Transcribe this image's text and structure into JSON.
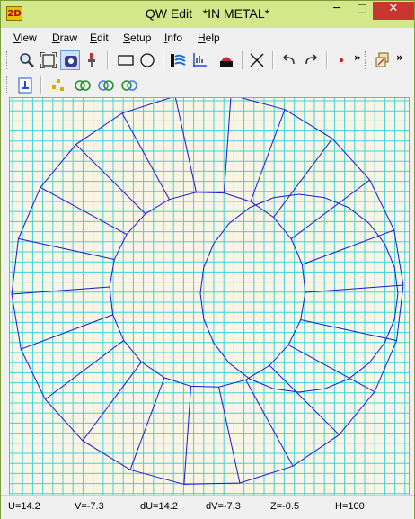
{
  "window": {
    "icon_text": "2D",
    "title": "QW Edit   *IN METAL*",
    "minimize": "─",
    "maximize": "□",
    "close": "✕"
  },
  "menu": [
    {
      "label": "View",
      "accel": "V",
      "rest": "iew"
    },
    {
      "label": "Draw",
      "accel": "D",
      "rest": "raw"
    },
    {
      "label": "Edit",
      "accel": "E",
      "rest": "dit"
    },
    {
      "label": "Setup",
      "accel": "S",
      "rest": "etup"
    },
    {
      "label": "Info",
      "accel": "I",
      "rest": "nfo"
    },
    {
      "label": "Help",
      "accel": "H",
      "rest": "elp"
    }
  ],
  "toolbar": {
    "overflow_1": "»",
    "overflow_2": "»",
    "icons": [
      "zoom-icon",
      "fit-view-icon",
      "select-mode-icon",
      "probe-icon",
      "rectangle-icon",
      "circle-icon",
      "hatch-icon",
      "axes-icon",
      "component-icon",
      "delete-cross-icon",
      "undo-icon",
      "redo-icon",
      "point-icon",
      "overflow-icon",
      "layers-icon",
      "overflow-icon"
    ],
    "icons_row2": [
      "info-icon",
      "nodes-icon",
      "ring-green-icon",
      "ring-blue-green-icon",
      "ring-dual-icon"
    ],
    "accent_colors": {
      "grid": "#3fd3dd",
      "mesh": "#1a1acc",
      "canvas_bg": "#faf4e4",
      "titlebar": "#d2e88a",
      "close": "#c7372f"
    }
  },
  "status": {
    "u": "U=14.2",
    "v": "V=-7.3",
    "du": "dU=14.2",
    "dv": "dV=-7.3",
    "z": "Z=-0.5",
    "h": "H=100"
  }
}
